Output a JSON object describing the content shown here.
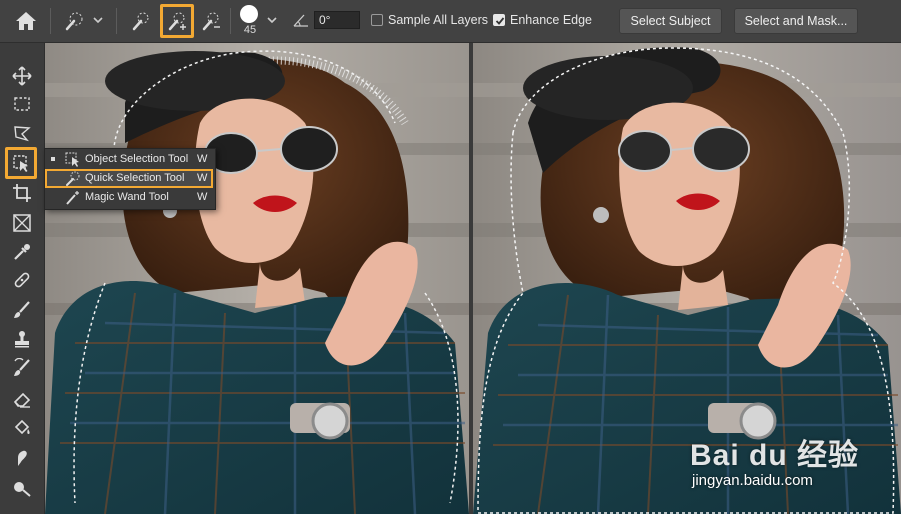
{
  "options_bar": {
    "brush_size": "45",
    "angle_value": "0°",
    "sample_all_layers_label": "Sample All Layers",
    "sample_all_layers_checked": false,
    "enhance_edge_label": "Enhance Edge",
    "enhance_edge_checked": true,
    "select_subject_label": "Select Subject",
    "select_and_mask_label": "Select and Mask..."
  },
  "tool_flyout": {
    "items": [
      {
        "label": "Object Selection Tool",
        "shortcut": "W",
        "icon": "object-selection-icon"
      },
      {
        "label": "Quick Selection Tool",
        "shortcut": "W",
        "icon": "quick-selection-icon"
      },
      {
        "label": "Magic Wand Tool",
        "shortcut": "W",
        "icon": "magic-wand-icon"
      }
    ]
  },
  "watermark": {
    "logo": "Bai du 经验",
    "url": "jingyan.baidu.com"
  },
  "colors": {
    "highlight": "#f3a933",
    "panel": "#424242",
    "toolbar": "#3c3c3c"
  }
}
